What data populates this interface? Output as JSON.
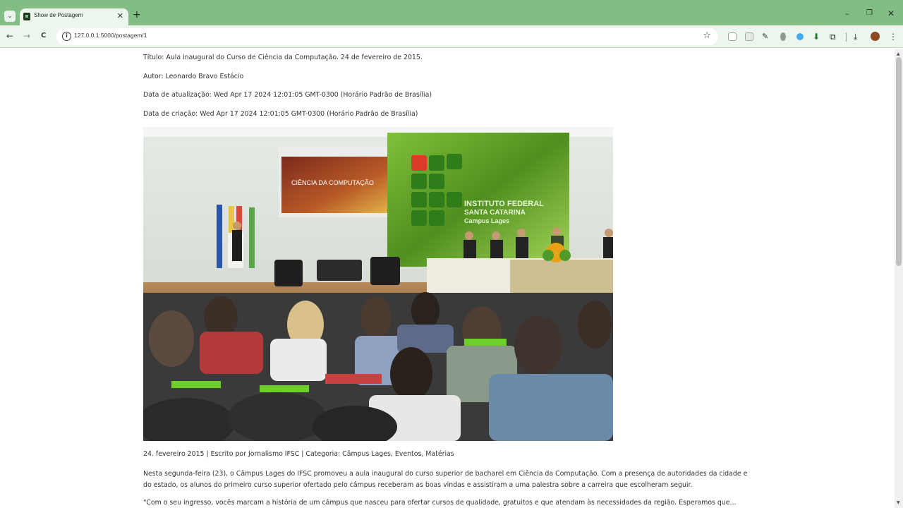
{
  "browser": {
    "tab_title": "Show de Postagem",
    "tab_close": "✕",
    "new_tab": "+",
    "url": "127.0.0.1:5000/postagem/1",
    "window_controls": {
      "minimize": "–",
      "maximize": "❐",
      "close": "✕"
    },
    "nav": {
      "back": "←",
      "forward": "→",
      "reload": "C"
    },
    "icons": [
      "search-tabs-icon",
      "info-icon",
      "bookmark-star-icon",
      "downloads-icon",
      "profile-avatar-icon",
      "menu-kebab-icon"
    ],
    "theme_color": "#82bd85"
  },
  "post": {
    "titulo": "Título: Aula inaugural do Curso de Ciência da Computação. 24 de fevereiro de 2015.",
    "autor": "Autor: Leonardo Bravo Estácio",
    "atualizacao": "Data de atualização: Wed Apr 17 2024 12:01:05 GMT-0300 (Horário Padrão de Brasília)",
    "criacao": "Data de criação: Wed Apr 17 2024 12:01:05 GMT-0300 (Horário Padrão de Brasília)",
    "image": {
      "projection_title": "CIÊNCIA DA COMPUTAÇÃO",
      "banner_line1": "INSTITUTO FEDERAL",
      "banner_line2": "SANTA CATARINA",
      "banner_line3": "Campus Lages"
    },
    "caption": "24. fevereiro 2015 | Escrito por Jornalismo IFSC | Categoria: Câmpus Lages, Eventos, Matérias",
    "paragraph1": "Nesta segunda-feira (23), o Câmpus Lages do IFSC promoveu a aula inaugural do curso superior de bacharel em Ciência da Computação. Com a presença de autoridades da cidade e do estado, os alunos do primeiro curso superior ofertado pelo câmpus receberam as boas vindas e assistiram a uma palestra sobre a carreira que escolheram seguir.",
    "paragraph2": "\"Com o seu ingresso, vocês marcam a história de um câmpus que nasceu para ofertar cursos de qualidade, gratuitos e que atendam às necessidades da região. Esperamos que..."
  }
}
